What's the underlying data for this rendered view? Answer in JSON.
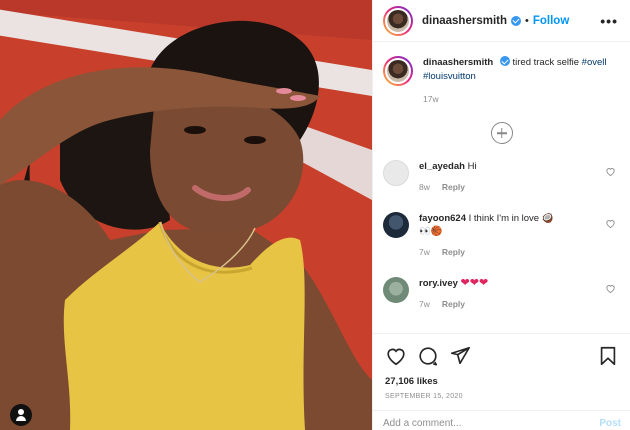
{
  "photo": {
    "alt_icon": "user-tag-icon"
  },
  "header": {
    "username": "dinaashersmith",
    "separator": "•",
    "follow_label": "Follow",
    "more_label": "•••"
  },
  "caption": {
    "username": "dinaashersmith",
    "text": "tired track selfie",
    "hashtags": "#ovell #louisvuitton",
    "time": "17w"
  },
  "comments": [
    {
      "username": "el_ayedah",
      "text": "Hi",
      "time": "8w",
      "reply": "Reply",
      "avatar_color": "#e9e9e9"
    },
    {
      "username": "fayoon624",
      "text": "I think I'm in love 🥥",
      "emoji_line": "👀🏀",
      "time": "7w",
      "reply": "Reply",
      "avatar_color": "#1c2a3a"
    },
    {
      "username": "rory.ivey",
      "text": "❤❤❤",
      "time": "7w",
      "reply": "Reply",
      "avatar_color": "#6f8a77"
    }
  ],
  "actions": {
    "likes": "27,106 likes",
    "date": "SEPTEMBER 15, 2020"
  },
  "add_comment": {
    "placeholder": "Add a comment...",
    "post_label": "Post"
  },
  "colors": {
    "accent": "#0095f6",
    "verified": "#3897f0",
    "track_red": "#c8402c",
    "top_yellow": "#e8c445"
  }
}
